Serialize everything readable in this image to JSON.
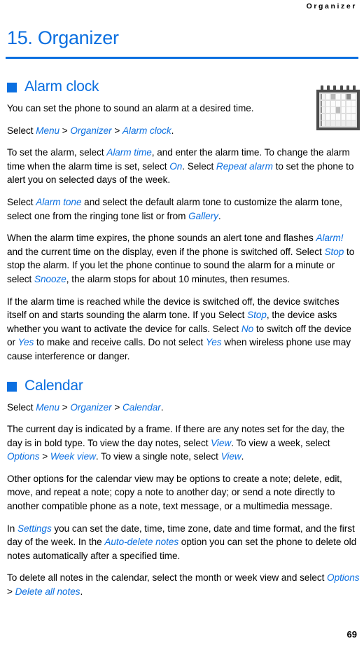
{
  "header": {
    "running_head": "Organizer"
  },
  "chapter": {
    "title": "15. Organizer",
    "rule_color": "#0b6fe0"
  },
  "colors": {
    "accent_blue": "#0b6fe0",
    "body_text": "#000000",
    "page_background": "#ffffff"
  },
  "icons": {
    "calendar": "calendar-icon",
    "bullet": "square-bullet-icon"
  },
  "sections": [
    {
      "id": "alarm-clock",
      "heading": "Alarm clock",
      "paragraphs": [
        {
          "id": "alarm-p1",
          "runs": [
            {
              "t": "You can set the phone to sound an alarm at a desired time.",
              "s": "plain"
            }
          ]
        },
        {
          "id": "alarm-p2",
          "runs": [
            {
              "t": "Select ",
              "s": "plain"
            },
            {
              "t": "Menu",
              "s": "ui"
            },
            {
              "t": " > ",
              "s": "plain"
            },
            {
              "t": "Organizer",
              "s": "ui"
            },
            {
              "t": " > ",
              "s": "plain"
            },
            {
              "t": "Alarm clock",
              "s": "ui"
            },
            {
              "t": ".",
              "s": "plain"
            }
          ]
        },
        {
          "id": "alarm-p3",
          "runs": [
            {
              "t": "To set the alarm, select ",
              "s": "plain"
            },
            {
              "t": "Alarm time",
              "s": "ui"
            },
            {
              "t": ", and enter the alarm time. To change the alarm time when the alarm time is set, select ",
              "s": "plain"
            },
            {
              "t": "On",
              "s": "ui"
            },
            {
              "t": ". Select ",
              "s": "plain"
            },
            {
              "t": "Repeat alarm",
              "s": "ui"
            },
            {
              "t": " to set the phone to alert you on selected days of the week.",
              "s": "plain"
            }
          ]
        },
        {
          "id": "alarm-p4",
          "runs": [
            {
              "t": "Select ",
              "s": "plain"
            },
            {
              "t": "Alarm tone",
              "s": "ui"
            },
            {
              "t": " and select the default alarm tone to customize the alarm tone, select one from the ringing tone list or from ",
              "s": "plain"
            },
            {
              "t": "Gallery",
              "s": "ui"
            },
            {
              "t": ".",
              "s": "plain"
            }
          ]
        },
        {
          "id": "alarm-p5",
          "runs": [
            {
              "t": "When the alarm time expires, the phone sounds an alert tone and flashes ",
              "s": "plain"
            },
            {
              "t": "Alarm!",
              "s": "ui"
            },
            {
              "t": " and the current time on the display, even if the phone is switched off. Select ",
              "s": "plain"
            },
            {
              "t": "Stop",
              "s": "ui"
            },
            {
              "t": " to stop the alarm. If you let the phone continue to sound the alarm for a minute or select ",
              "s": "plain"
            },
            {
              "t": "Snooze",
              "s": "ui"
            },
            {
              "t": ", the alarm stops for about 10 minutes, then resumes.",
              "s": "plain"
            }
          ]
        },
        {
          "id": "alarm-p6",
          "runs": [
            {
              "t": "If the alarm time is reached while the device is switched off, the device switches itself on and starts sounding the alarm tone. If you Select ",
              "s": "plain"
            },
            {
              "t": "Stop",
              "s": "ui"
            },
            {
              "t": ", the device asks whether you want to activate the device for calls. Select ",
              "s": "plain"
            },
            {
              "t": "No",
              "s": "ui"
            },
            {
              "t": " to switch off the device or ",
              "s": "plain"
            },
            {
              "t": "Yes",
              "s": "ui"
            },
            {
              "t": " to make and receive calls. Do not select ",
              "s": "plain"
            },
            {
              "t": "Yes",
              "s": "ui"
            },
            {
              "t": " when wireless phone use may cause interference or danger.",
              "s": "plain"
            }
          ]
        }
      ]
    },
    {
      "id": "calendar",
      "heading": "Calendar",
      "paragraphs": [
        {
          "id": "cal-p1",
          "runs": [
            {
              "t": "Select ",
              "s": "plain"
            },
            {
              "t": "Menu",
              "s": "ui"
            },
            {
              "t": " > ",
              "s": "plain"
            },
            {
              "t": "Organizer",
              "s": "ui"
            },
            {
              "t": " > ",
              "s": "plain"
            },
            {
              "t": "Calendar",
              "s": "ui"
            },
            {
              "t": ".",
              "s": "plain"
            }
          ]
        },
        {
          "id": "cal-p2",
          "runs": [
            {
              "t": "The current day is indicated by a frame. If there are any notes set for the day, the day is in bold type. To view the day notes, select ",
              "s": "plain"
            },
            {
              "t": "View",
              "s": "ui"
            },
            {
              "t": ". To view a week, select ",
              "s": "plain"
            },
            {
              "t": "Options",
              "s": "ui"
            },
            {
              "t": " > ",
              "s": "plain"
            },
            {
              "t": "Week view",
              "s": "ui"
            },
            {
              "t": ". To view a single note, select ",
              "s": "plain"
            },
            {
              "t": "View",
              "s": "ui"
            },
            {
              "t": ".",
              "s": "plain"
            }
          ]
        },
        {
          "id": "cal-p3",
          "runs": [
            {
              "t": "Other options for the calendar view may be options to create a note; delete, edit, move, and repeat a note; copy a note to another day; or send a note directly to another compatible phone as a note, text message, or a multimedia message.",
              "s": "plain"
            }
          ]
        },
        {
          "id": "cal-p4",
          "runs": [
            {
              "t": "In ",
              "s": "plain"
            },
            {
              "t": "Settings",
              "s": "ui"
            },
            {
              "t": " you can set the date, time, time zone, date and time format, and the first day of the week. In the ",
              "s": "plain"
            },
            {
              "t": "Auto-delete notes",
              "s": "ui"
            },
            {
              "t": " option you can set the phone to delete old notes automatically after a specified time.",
              "s": "plain"
            }
          ]
        },
        {
          "id": "cal-p5",
          "runs": [
            {
              "t": "To delete all notes in the calendar, select the month or week view and select ",
              "s": "plain"
            },
            {
              "t": "Options",
              "s": "ui"
            },
            {
              "t": " > ",
              "s": "plain"
            },
            {
              "t": "Delete all notes",
              "s": "ui"
            },
            {
              "t": ".",
              "s": "plain"
            }
          ]
        }
      ]
    }
  ],
  "footer": {
    "page_number": "69"
  }
}
